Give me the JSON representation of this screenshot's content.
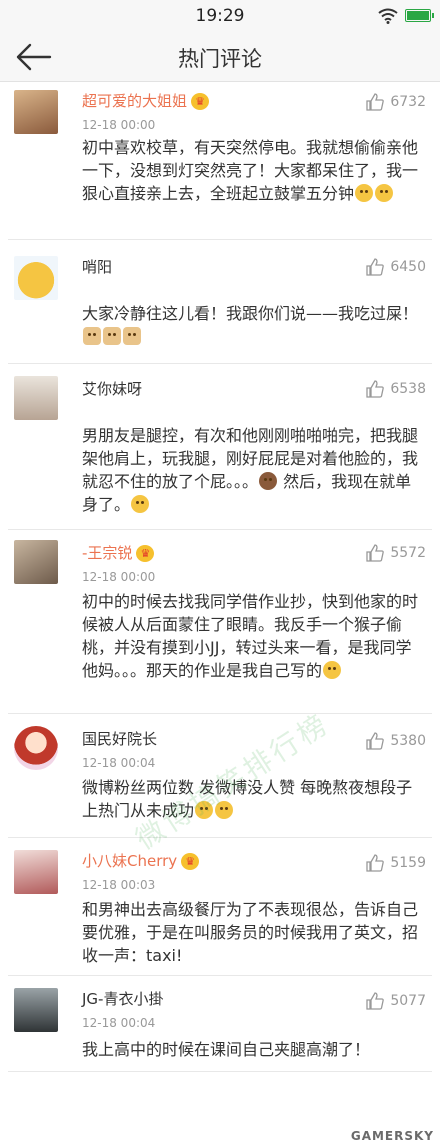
{
  "status_bar": {
    "time": "19:29"
  },
  "nav": {
    "title": "热门评论"
  },
  "comments": [
    {
      "user": "超可爱的大姐姐",
      "vip": true,
      "time": "12-18 00:00",
      "likes": "6732",
      "text": "初中喜欢校草，有天突然停电。我就想偷偷亲他一下，没想到灯突然亮了！大家都呆住了，我一狠心直接亲上去，全班起立鼓掌五分钟",
      "emojis": [
        "laugh-cry-emoji",
        "laugh-cry-emoji"
      ]
    },
    {
      "user": "哨阳",
      "vip": false,
      "time": "",
      "likes": "6450",
      "text": "大家冷静往这儿看！我跟你们说——我吃过屎！",
      "emojis": [
        "dog-emoji",
        "dog-emoji",
        "dog-emoji"
      ]
    },
    {
      "user": "艾你妹呀",
      "vip": false,
      "time": "",
      "likes": "6538",
      "text": "男朋友是腿控，有次和他刚刚啪啪啪完，把我腿架他肩上，玩我腿，刚好屁屁是对着他脸的，我就忍不住的放了个屁。。。",
      "text_after": " 然后，我现在就单身了。",
      "emojis_mid": [
        "see-no-evil-emoji"
      ],
      "emojis": [
        "smile-emoji"
      ]
    },
    {
      "user": "-王宗锐",
      "vip": true,
      "time": "12-18 00:00",
      "likes": "5572",
      "text": "初中的时候去找我同学借作业抄，快到他家的时候被人从后面蒙住了眼睛。我反手一个猴子偷桃，并没有摸到小JJ，转过头来一看，是我同学他妈。。。那天的作业是我自己写的",
      "emojis": [
        "clap-emoji"
      ]
    },
    {
      "user": "国民好院长",
      "vip": false,
      "time": "12-18 00:04",
      "likes": "5380",
      "text": "微博粉丝两位数 发微博没人赞 每晚熬夜想段子上热门从未成功",
      "emojis": [
        "think-emoji",
        "think-emoji"
      ]
    },
    {
      "user": "小八妹Cherry",
      "vip": true,
      "time": "12-18 00:03",
      "likes": "5159",
      "text": "和男神出去高级餐厅为了不表现很怂，告诉自己要优雅，于是在叫服务员的时候我用了英文，招收一声：taxi!",
      "emojis": []
    },
    {
      "user": "JG-青衣小掛",
      "vip": false,
      "time": "12-18 00:04",
      "likes": "5077",
      "text": "我上高中的时候在课间自己夹腿高潮了！",
      "emojis": []
    }
  ],
  "watermark": "微博搞笑排行榜",
  "corner_mark": "GAMERSKY"
}
